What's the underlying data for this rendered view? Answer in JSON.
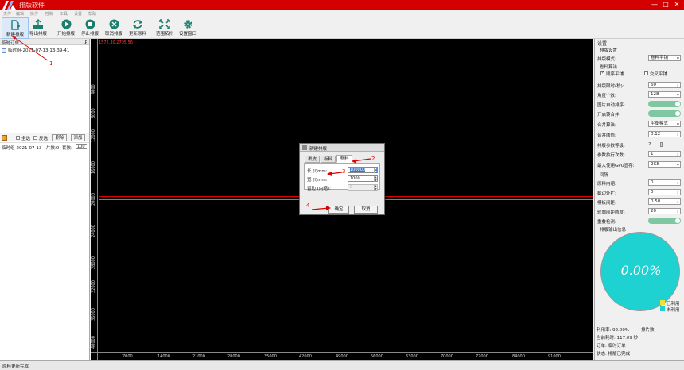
{
  "app": {
    "title": "排版软件",
    "window_controls": [
      "—",
      "□",
      "✕"
    ]
  },
  "menu": [
    "文件",
    "编辑",
    "操作",
    "控制",
    "工具",
    "设置",
    "帮助"
  ],
  "toolbar": [
    {
      "label": "新建排版",
      "icon": "new-doc-icon"
    },
    {
      "label": "导出排版",
      "icon": "export-icon"
    },
    {
      "label": "开始排版",
      "icon": "play-icon"
    },
    {
      "label": "停止排版",
      "icon": "stop-icon"
    },
    {
      "label": "取消排版",
      "icon": "cancel-icon"
    },
    {
      "label": "更新原料",
      "icon": "refresh-icon"
    },
    {
      "label": "范围拓扑",
      "icon": "expand-icon"
    },
    {
      "label": "设置窗口",
      "icon": "gear-icon"
    }
  ],
  "left_panel": {
    "header": "临时订单",
    "pin": "ꝑ",
    "order": "临时组-2021-07-13-13-39-41",
    "select_all": "全选",
    "invert": "反选",
    "delete": "删除",
    "add": "添加",
    "info": "临时组-2021-07-13-",
    "pieces": "片数:0",
    "quantity_label": "套数:",
    "quantity": "100"
  },
  "canvas": {
    "coord": "1572.30,2705.56",
    "ruler_x": [
      "7000",
      "14000",
      "21000",
      "28000",
      "35000",
      "42000",
      "49000",
      "56000",
      "63000",
      "70000",
      "77000",
      "84000",
      "91000"
    ],
    "ruler_y": [
      "4000",
      "8000",
      "12000",
      "16000",
      "20000",
      "24000",
      "28000",
      "32000",
      "36000",
      "40000"
    ]
  },
  "dialog": {
    "title": "新建排版",
    "close": "✕",
    "tabs": [
      "裹皮",
      "板料",
      "卷料"
    ],
    "active_tab": 2,
    "length_label": "长 (l)mm:",
    "length_value": "100000",
    "width_label": "宽 (l)mm:",
    "width_value": "1000",
    "margin_label": "留边 (内缩):",
    "margin_value": "0",
    "ok": "确定",
    "cancel": "取消"
  },
  "annotations": [
    "1",
    "2",
    "3",
    "4"
  ],
  "annotation_color": "#e00000",
  "right_panel": {
    "title": "设置",
    "section1": "排版设置",
    "mode_label": "排版模式:",
    "mode_value": "卷料平铺",
    "algo_label": "卷料算法",
    "algo_opt1": "顺序平铺",
    "algo_opt1_checked": true,
    "algo_opt2": "交叉平铺",
    "algo_opt2_checked": false,
    "time_label": "排版限时(秒):",
    "time_value": "60",
    "angle_label": "角度个数:",
    "angle_value": "128",
    "auto_sort_label": "图片自动排序:",
    "merge_on_label": "开启转合并:",
    "merge_algo_label": "合并算法:",
    "merge_algo_value": "平衡模式",
    "merge_threshold_label": "合并阈值:",
    "merge_threshold_value": "0.12",
    "param_level_label": "排版参数等级:",
    "param_level_value": "2",
    "exec_count_label": "参数执行次数:",
    "exec_count_value": "1",
    "max_gpu_label": "最大使用GPU显存:",
    "max_gpu_value": "2GB",
    "section2": "间隔",
    "inner_gap_label": "原料内缩:",
    "inner_gap_value": "0",
    "ext_label": "截边外扩:",
    "ext_value": "0",
    "block_gap_label": "模板间距:",
    "block_gap_value": "0.50",
    "outline_label": "轮廓间距圆度:",
    "outline_value": "20",
    "overlap_label": "重叠检测:",
    "section3": "排版输出信息",
    "pie_label": "0.00%",
    "used_fraction": 0.0,
    "legend_used": "已利用",
    "legend_unused": "未利用",
    "color_used": "#f2e03a",
    "color_unused": "#1fd2d2",
    "utilization": "利用率: 92.00%",
    "pieces": "排片数:",
    "elapsed": "当前耗时: 117.09 秒",
    "order": "订单: 临时订单",
    "status": "状态: 排版已完成"
  },
  "status_bar": "原料更新完成"
}
